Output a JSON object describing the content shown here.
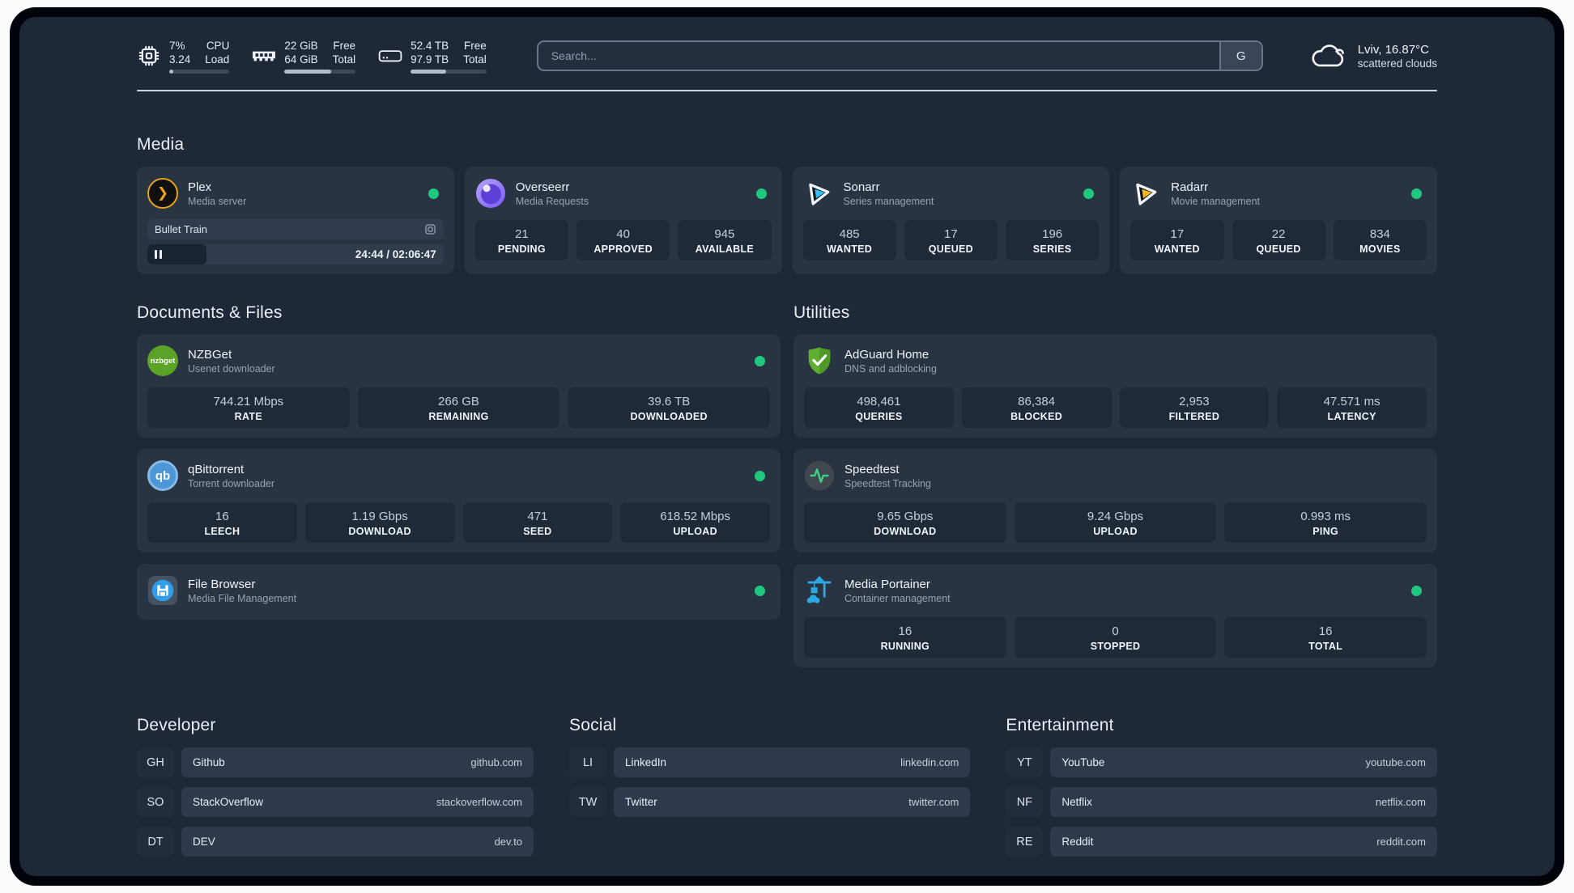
{
  "header": {
    "resources": [
      {
        "value1": "7%",
        "value2": "3.24",
        "label1": "CPU",
        "label2": "Load",
        "progress": 7
      },
      {
        "value1": "22 GiB",
        "value2": "64 GiB",
        "label1": "Free",
        "label2": "Total",
        "progress": 66
      },
      {
        "value1": "52.4 TB",
        "value2": "97.9 TB",
        "label1": "Free",
        "label2": "Total",
        "progress": 47
      }
    ],
    "search": {
      "placeholder": "Search...",
      "button_label": "G"
    },
    "weather": {
      "location": "Lviv, 16.87°C",
      "condition": "scattered clouds"
    }
  },
  "media": {
    "title": "Media",
    "plex": {
      "title": "Plex",
      "subtitle": "Media server",
      "now_playing": "Bullet Train",
      "time": "24:44 / 02:06:47",
      "progress": 20
    },
    "overseerr": {
      "title": "Overseerr",
      "subtitle": "Media Requests",
      "stats": [
        {
          "value": "21",
          "label": "PENDING"
        },
        {
          "value": "40",
          "label": "APPROVED"
        },
        {
          "value": "945",
          "label": "AVAILABLE"
        }
      ]
    },
    "sonarr": {
      "title": "Sonarr",
      "subtitle": "Series management",
      "stats": [
        {
          "value": "485",
          "label": "WANTED"
        },
        {
          "value": "17",
          "label": "QUEUED"
        },
        {
          "value": "196",
          "label": "SERIES"
        }
      ]
    },
    "radarr": {
      "title": "Radarr",
      "subtitle": "Movie management",
      "stats": [
        {
          "value": "17",
          "label": "WANTED"
        },
        {
          "value": "22",
          "label": "QUEUED"
        },
        {
          "value": "834",
          "label": "MOVIES"
        }
      ]
    }
  },
  "documents": {
    "title": "Documents & Files",
    "nzbget": {
      "title": "NZBGet",
      "subtitle": "Usenet downloader",
      "stats": [
        {
          "value": "744.21 Mbps",
          "label": "RATE"
        },
        {
          "value": "266 GB",
          "label": "REMAINING"
        },
        {
          "value": "39.6 TB",
          "label": "DOWNLOADED"
        }
      ]
    },
    "qbittorrent": {
      "title": "qBittorrent",
      "subtitle": "Torrent downloader",
      "stats": [
        {
          "value": "16",
          "label": "LEECH"
        },
        {
          "value": "1.19 Gbps",
          "label": "DOWNLOAD"
        },
        {
          "value": "471",
          "label": "SEED"
        },
        {
          "value": "618.52 Mbps",
          "label": "UPLOAD"
        }
      ]
    },
    "filebrowser": {
      "title": "File Browser",
      "subtitle": "Media File Management"
    }
  },
  "utilities": {
    "title": "Utilities",
    "adguard": {
      "title": "AdGuard Home",
      "subtitle": "DNS and adblocking",
      "stats": [
        {
          "value": "498,461",
          "label": "QUERIES"
        },
        {
          "value": "86,384",
          "label": "BLOCKED"
        },
        {
          "value": "2,953",
          "label": "FILTERED"
        },
        {
          "value": "47.571 ms",
          "label": "LATENCY"
        }
      ]
    },
    "speedtest": {
      "title": "Speedtest",
      "subtitle": "Speedtest Tracking",
      "stats": [
        {
          "value": "9.65 Gbps",
          "label": "DOWNLOAD"
        },
        {
          "value": "9.24 Gbps",
          "label": "UPLOAD"
        },
        {
          "value": "0.993 ms",
          "label": "PING"
        }
      ]
    },
    "portainer": {
      "title": "Media Portainer",
      "subtitle": "Container management",
      "stats": [
        {
          "value": "16",
          "label": "RUNNING"
        },
        {
          "value": "0",
          "label": "STOPPED"
        },
        {
          "value": "16",
          "label": "TOTAL"
        }
      ]
    }
  },
  "links": {
    "developer": {
      "title": "Developer",
      "items": [
        {
          "abbr": "GH",
          "name": "Github",
          "url": "github.com"
        },
        {
          "abbr": "SO",
          "name": "StackOverflow",
          "url": "stackoverflow.com"
        },
        {
          "abbr": "DT",
          "name": "DEV",
          "url": "dev.to"
        }
      ]
    },
    "social": {
      "title": "Social",
      "items": [
        {
          "abbr": "LI",
          "name": "LinkedIn",
          "url": "linkedin.com"
        },
        {
          "abbr": "TW",
          "name": "Twitter",
          "url": "twitter.com"
        }
      ]
    },
    "entertainment": {
      "title": "Entertainment",
      "items": [
        {
          "abbr": "YT",
          "name": "YouTube",
          "url": "youtube.com"
        },
        {
          "abbr": "NF",
          "name": "Netflix",
          "url": "netflix.com"
        },
        {
          "abbr": "RE",
          "name": "Reddit",
          "url": "reddit.com"
        }
      ]
    }
  },
  "colors": {
    "status_online": "#1fc77f",
    "plex_accent": "#e7a019",
    "sonarr_accent": "#35bef0",
    "radarr_accent": "#f7b520"
  }
}
